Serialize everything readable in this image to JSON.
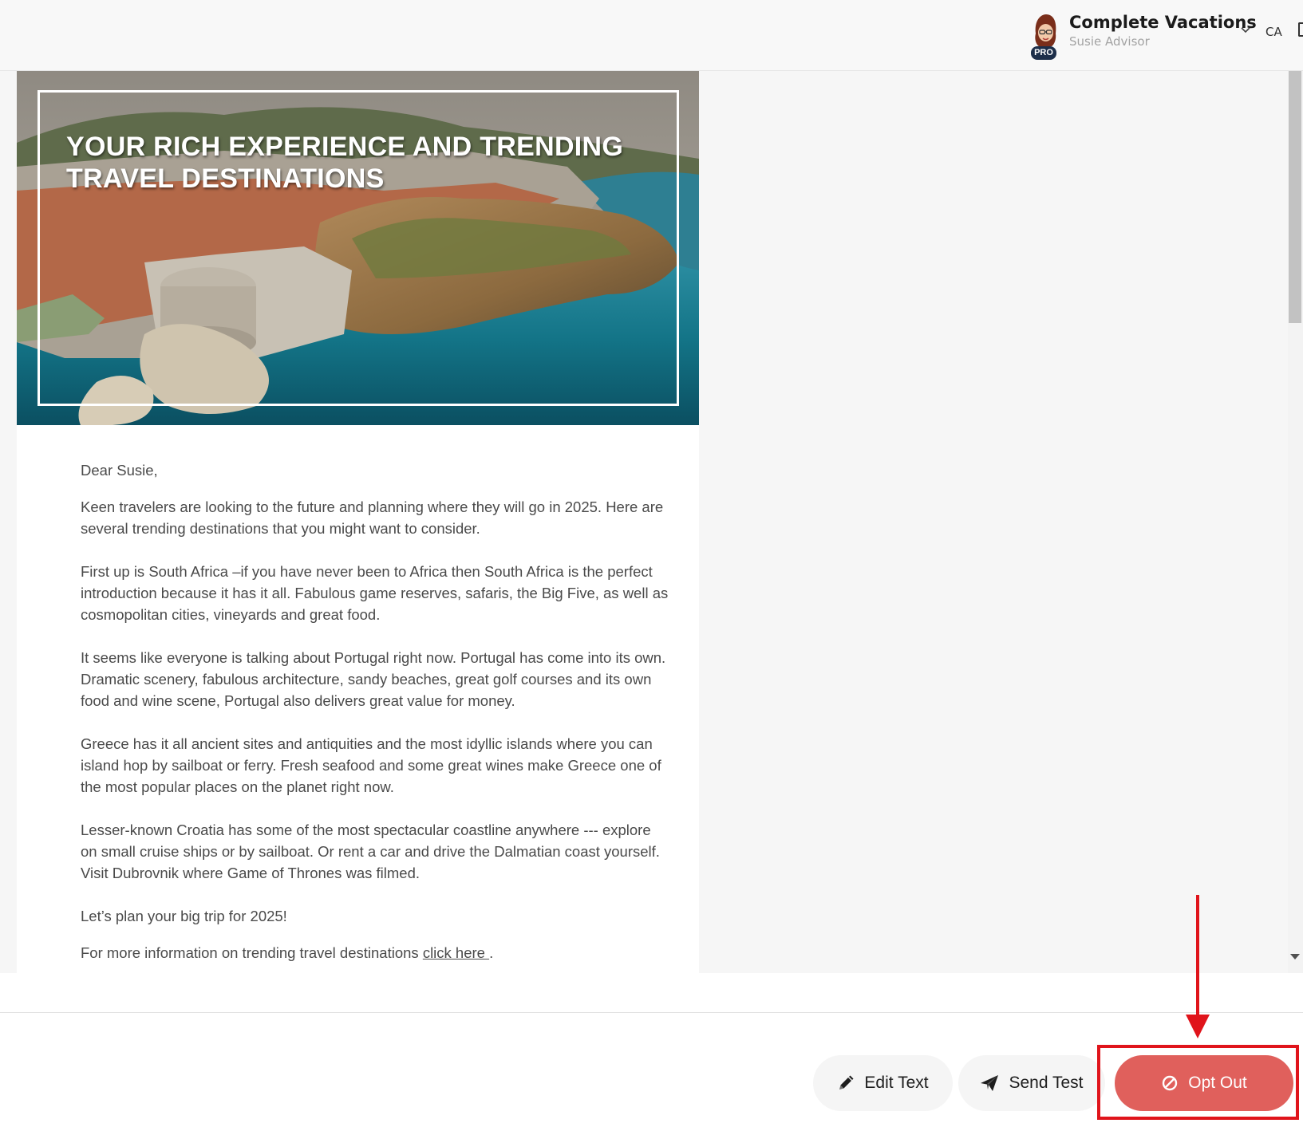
{
  "header": {
    "account_name": "Complete Vacations",
    "account_sub": "Susie Advisor",
    "badge": "PRO",
    "language": "CA",
    "avatar_icon": "advisor-avatar-icon",
    "dropdown_icon": "chevron-down-icon"
  },
  "email": {
    "hero_title": "YOUR RICH EXPERIENCE AND TRENDING TRAVEL DESTINATIONS",
    "greeting": "Dear Susie,",
    "paragraphs": [
      "Keen travelers are looking to the future and planning where they will go in 2025. Here are several trending destinations that you might want to consider.",
      "First up is South Africa –if you have never been to Africa then South Africa is the perfect introduction because it has it all. Fabulous game reserves, safaris, the Big Five, as well as cosmopolitan cities, vineyards and great food.",
      "It seems like everyone is talking about Portugal right now. Portugal has come into its own. Dramatic scenery, fabulous architecture, sandy beaches, great golf courses and its own food and wine scene, Portugal also delivers great value for money.",
      "Greece has it all ancient sites and antiquities and the most idyllic islands where you can island hop by sailboat or ferry. Fresh seafood and some great wines make Greece one of the most popular places on the planet right now.",
      "Lesser-known Croatia has some of the most spectacular coastline anywhere --- explore on small cruise ships or by sailboat. Or rent a car and drive the Dalmatian coast yourself.  Visit Dubrovnik where Game of Thrones was filmed."
    ],
    "closing": "Let’s plan your big trip for 2025!",
    "more_info_prefix": "For more information on trending travel destinations ",
    "more_info_link": "click here ",
    "more_info_suffix": "."
  },
  "actions": {
    "edit_text": "Edit Text",
    "send_test": "Send Test",
    "opt_out": "Opt Out",
    "edit_icon": "pencil-icon",
    "send_icon": "paper-plane-icon",
    "opt_out_icon": "prohibited-icon"
  },
  "colors": {
    "opt_out_button": "#e0605c",
    "annotation": "#e0141b"
  }
}
